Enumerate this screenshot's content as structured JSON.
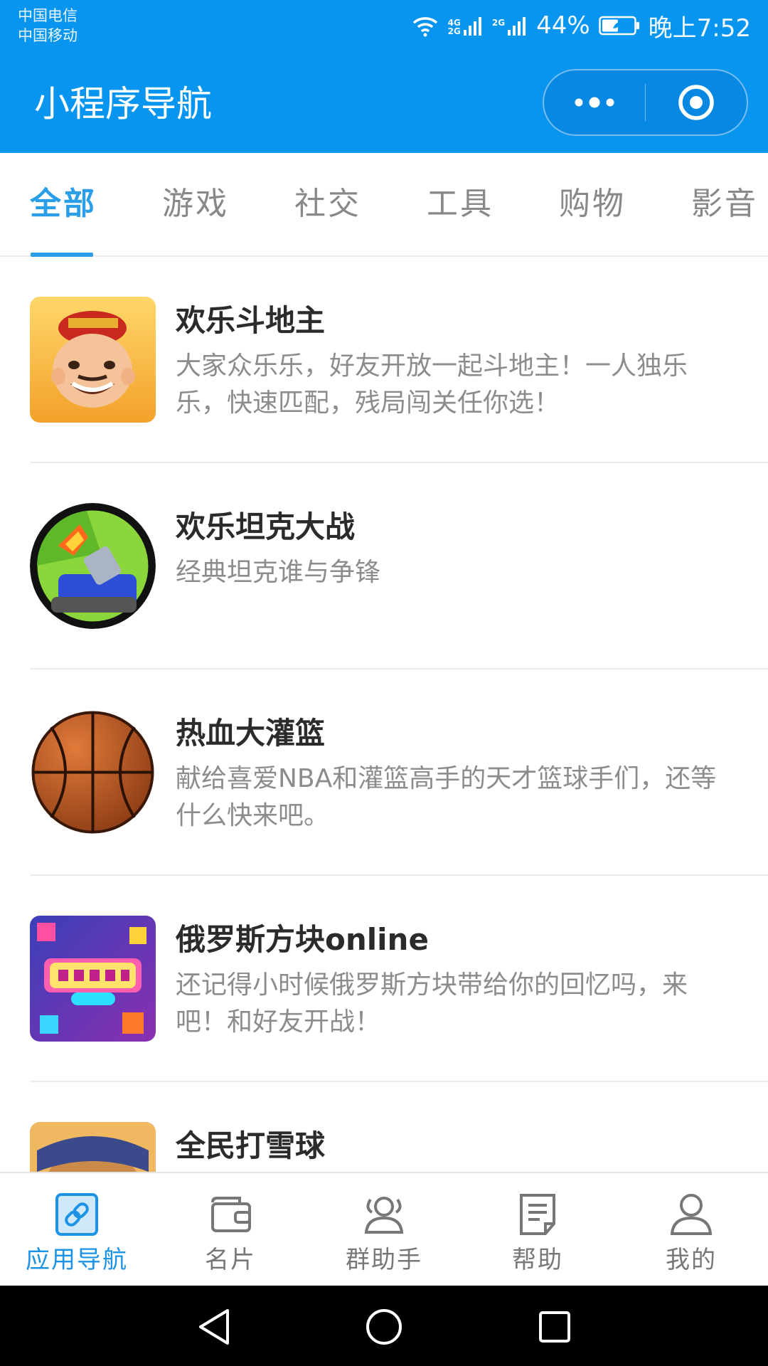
{
  "status_bar": {
    "carrier_1": "中国电信",
    "carrier_2": "中国移动",
    "network_1_top": "4G",
    "network_1_bottom": "2G",
    "network_2": "2G",
    "battery": "44%",
    "time": "晚上7:52"
  },
  "title_bar": {
    "title": "小程序导航",
    "more_icon": "more-dots-icon",
    "close_icon": "target-circle-icon"
  },
  "tabs": [
    {
      "label": "全部",
      "active": true
    },
    {
      "label": "游戏",
      "active": false
    },
    {
      "label": "社交",
      "active": false
    },
    {
      "label": "工具",
      "active": false
    },
    {
      "label": "购物",
      "active": false
    },
    {
      "label": "影音",
      "active": false
    }
  ],
  "apps": [
    {
      "name": "欢乐斗地主",
      "desc": "大家众乐乐，好友开放一起斗地主！一人独乐乐，快速匹配，残局闯关任你选！",
      "icon": "landlord-character-icon"
    },
    {
      "name": "欢乐坦克大战",
      "desc": "经典坦克谁与争锋",
      "icon": "tank-icon"
    },
    {
      "name": "热血大灌篮",
      "desc": "献给喜爱NBA和灌篮高手的天才篮球手们，还等什么快来吧。",
      "icon": "basketball-icon"
    },
    {
      "name": "俄罗斯方块online",
      "desc": "还记得小时候俄罗斯方块带给你的回忆吗，来吧！和好友开战！",
      "icon": "tetris-logo-icon"
    },
    {
      "name": "全民打雪球",
      "desc": "",
      "icon": "snowball-character-icon"
    }
  ],
  "bottom_nav": [
    {
      "label": "应用导航",
      "icon": "link-icon",
      "active": true
    },
    {
      "label": "名片",
      "icon": "wallet-icon",
      "active": false
    },
    {
      "label": "群助手",
      "icon": "group-icon",
      "active": false
    },
    {
      "label": "帮助",
      "icon": "document-icon",
      "active": false
    },
    {
      "label": "我的",
      "icon": "user-icon",
      "active": false
    }
  ],
  "system_nav": [
    "back-triangle-icon",
    "home-circle-icon",
    "recents-square-icon"
  ],
  "colors": {
    "primary": "#0895ef",
    "accent": "#2a9ee8",
    "text": "#2b2b2b",
    "muted": "#8c8c8c"
  }
}
